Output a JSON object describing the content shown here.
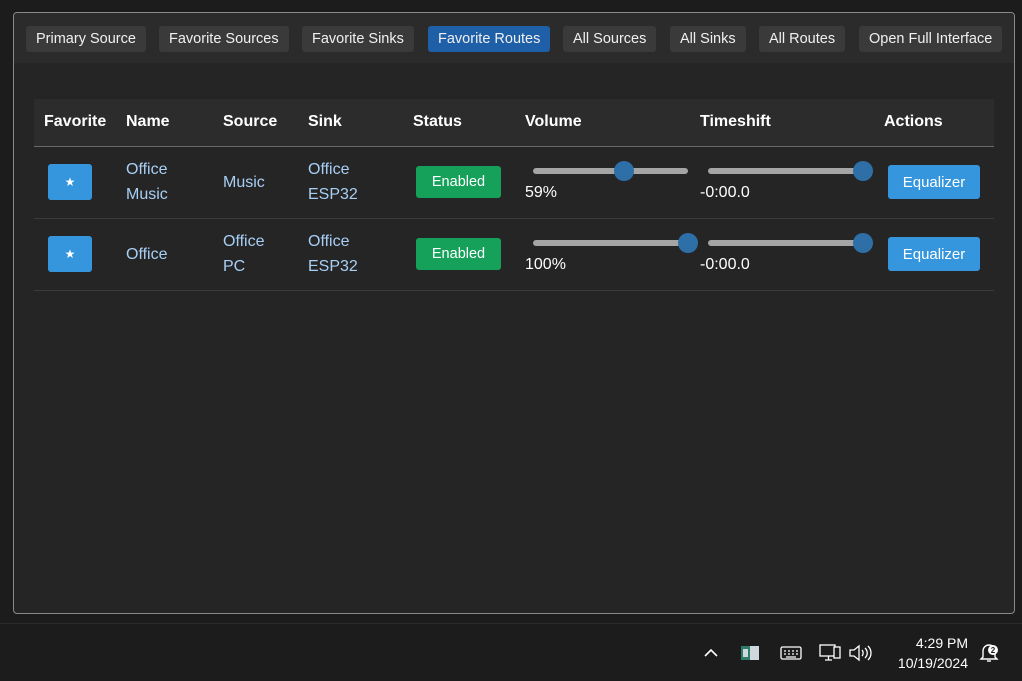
{
  "tabs": [
    {
      "label": "Primary Source",
      "active": false
    },
    {
      "label": "Favorite Sources",
      "active": false
    },
    {
      "label": "Favorite Sinks",
      "active": false
    },
    {
      "label": "Favorite Routes",
      "active": true
    },
    {
      "label": "All Sources",
      "active": false
    },
    {
      "label": "All Sinks",
      "active": false
    },
    {
      "label": "All Routes",
      "active": false
    },
    {
      "label": "Open Full Interface",
      "active": false
    }
  ],
  "table": {
    "headers": [
      "Favorite",
      "Name",
      "Source",
      "Sink",
      "Status",
      "Volume",
      "Timeshift",
      "Actions"
    ],
    "rows": [
      {
        "favorite": "★",
        "name_line1": "Office",
        "name_line2": "Music",
        "source_line1": "Music",
        "source_line2": "",
        "sink_line1": "Office",
        "sink_line2": "ESP32",
        "status": "Enabled",
        "volume": 0.59,
        "volume_label": "59%",
        "timeshift": 1.0,
        "timeshift_label": "-0:00.0",
        "action": "Equalizer"
      },
      {
        "favorite": "★",
        "name_line1": "Office",
        "name_line2": "",
        "source_line1": "Office",
        "source_line2": "PC",
        "sink_line1": "Office",
        "sink_line2": "ESP32",
        "status": "Enabled",
        "volume": 1.0,
        "volume_label": "100%",
        "timeshift": 1.0,
        "timeshift_label": "-0:00.0",
        "action": "Equalizer"
      }
    ]
  },
  "taskbar": {
    "time": "4:29 PM",
    "date": "10/19/2024",
    "icons": [
      "chevron-up-icon",
      "app-tray-icon",
      "keyboard-icon",
      "network-icon",
      "volume-icon",
      "notification-icon"
    ],
    "notification_count": "2"
  },
  "colors": {
    "accent": "#3596dd",
    "active_tab": "#1f5fa8",
    "enabled": "#16a15a",
    "link": "#a8cff5"
  }
}
